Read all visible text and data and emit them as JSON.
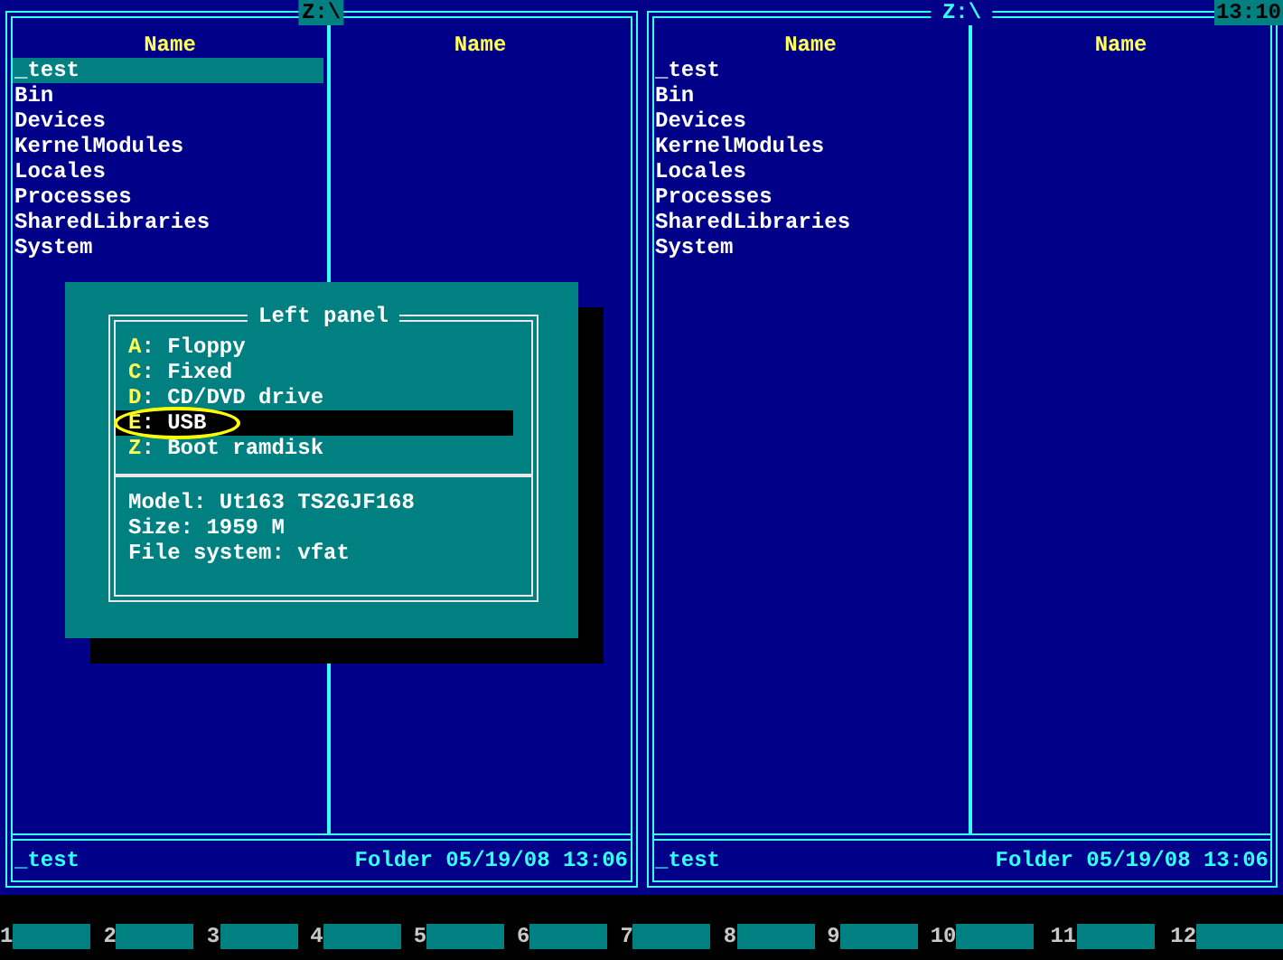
{
  "panels": [
    {
      "path": "Z:\\",
      "active": true,
      "columns": [
        {
          "heading": "Name",
          "files": [
            {
              "name": "_test",
              "selected": true
            },
            {
              "name": "Bin",
              "selected": false
            },
            {
              "name": "Devices",
              "selected": false
            },
            {
              "name": "KernelModules",
              "selected": false
            },
            {
              "name": "Locales",
              "selected": false
            },
            {
              "name": "Processes",
              "selected": false
            },
            {
              "name": "SharedLibraries",
              "selected": false
            },
            {
              "name": "System",
              "selected": false
            }
          ]
        },
        {
          "heading": "Name"
        }
      ],
      "footer": {
        "name": "_test",
        "info": "Folder 05/19/08 13:06"
      }
    },
    {
      "path": "Z:\\",
      "active": false,
      "columns": [
        {
          "heading": "Name",
          "files": [
            {
              "name": "_test",
              "selected": false
            },
            {
              "name": "Bin",
              "selected": false
            },
            {
              "name": "Devices",
              "selected": false
            },
            {
              "name": "KernelModules",
              "selected": false
            },
            {
              "name": "Locales",
              "selected": false
            },
            {
              "name": "Processes",
              "selected": false
            },
            {
              "name": "SharedLibraries",
              "selected": false
            },
            {
              "name": "System",
              "selected": false
            }
          ]
        },
        {
          "heading": "Name"
        }
      ],
      "footer": {
        "name": "_test",
        "info": "Folder 05/19/08 13:06"
      }
    }
  ],
  "clock": "13:10",
  "drive_dialog": {
    "title": "Left panel",
    "drives": [
      {
        "letter": "A",
        "rest": ": Floppy",
        "selected": false,
        "circled": false
      },
      {
        "letter": "C",
        "rest": ": Fixed",
        "selected": false,
        "circled": false
      },
      {
        "letter": "D",
        "rest": ": CD/DVD drive",
        "selected": false,
        "circled": false
      },
      {
        "letter": "E",
        "rest": ": USB",
        "selected": true,
        "circled": true
      },
      {
        "letter": "Z",
        "rest": ": Boot ramdisk",
        "selected": false,
        "circled": false
      }
    ],
    "info": [
      "Model: Ut163 TS2GJF168",
      "Size: 1959 M",
      "File system: vfat"
    ]
  },
  "function_keys": [
    {
      "number": "1"
    },
    {
      "number": "2"
    },
    {
      "number": "3"
    },
    {
      "number": "4"
    },
    {
      "number": "5"
    },
    {
      "number": "6"
    },
    {
      "number": "7"
    },
    {
      "number": "8"
    },
    {
      "number": "9"
    },
    {
      "number": "10"
    },
    {
      "number": "11"
    },
    {
      "number": "12"
    }
  ]
}
